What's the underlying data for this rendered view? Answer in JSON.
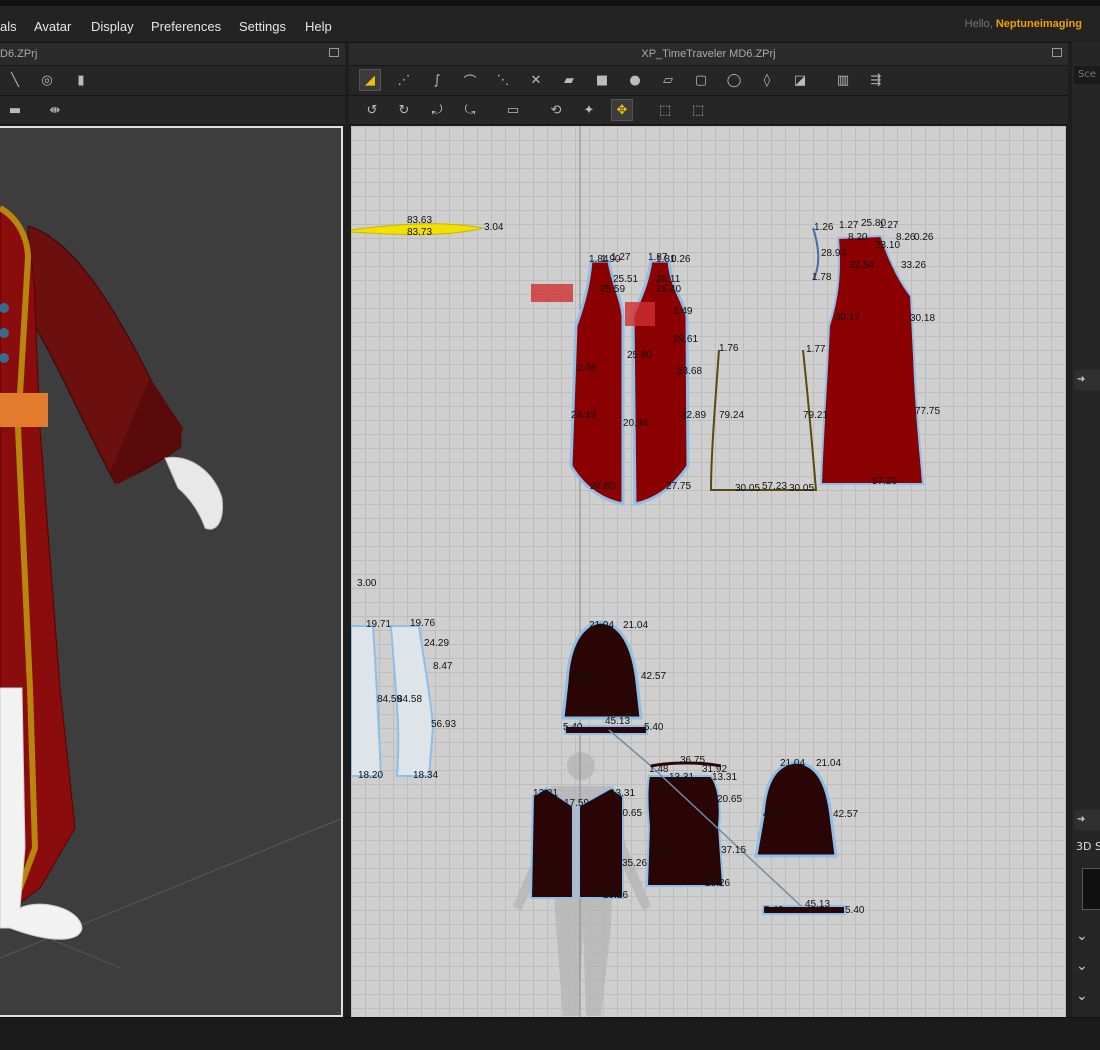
{
  "menu": {
    "items": [
      "als",
      "Avatar",
      "Display",
      "Preferences",
      "Settings",
      "Help"
    ],
    "hello_prefix": "Hello,",
    "user": "Neptuneimaging"
  },
  "panel3d": {
    "title": "D6.ZPrj"
  },
  "panel2d": {
    "title": "XP_TimeTraveler MD6.ZPrj"
  },
  "right_panel": {
    "search_label": "Sce",
    "section_label": "3D S"
  },
  "patterns": {
    "labels": [
      "83.63",
      "83.73",
      "3.04",
      "1.84",
      "1.90",
      "1.27",
      "1.87",
      "1.81",
      "0.26",
      "25.51",
      "25.59",
      "26.11",
      "26.40",
      "1.49",
      "29.61",
      "2.06",
      "24.49",
      "20.94",
      "25.80",
      "33.68",
      "32.89",
      "24.80",
      "27.75",
      "1.76",
      "1.77",
      "79.24",
      "79.21",
      "30.05",
      "57.23",
      "30.05",
      "1.26",
      "1.27",
      "25.80",
      "1.27",
      "0.26",
      "8.20",
      "8.26",
      "23.10",
      "28.94",
      "32.54",
      "33.26",
      "1.78",
      "30.17",
      "30.18",
      "77.75",
      "57.20",
      "3.00",
      "19.71",
      "19.76",
      "24.29",
      "8.47",
      "84.59",
      "84.58",
      "56.93",
      "18.20",
      "18.34",
      "21.04",
      "21.04",
      "42.57",
      "42.57",
      "5.40",
      "45.13",
      "5.40",
      "13.31",
      "17.59",
      "13.31",
      "20.65",
      "35.25",
      "35.26",
      "20.26",
      "36.75",
      "1.48",
      "13.31",
      "31.92",
      "13.31",
      "20.65",
      "37.15",
      "37.15",
      "20.26",
      "21.04",
      "21.04",
      "42.57",
      "42.57",
      "5.40",
      "45.13",
      "5.40"
    ]
  },
  "colors": {
    "accent": "#f0a000",
    "garment_red": "#8b0000",
    "garment_dark": "#2a0505",
    "select_outline": "#8fbfe6",
    "selected_yellow": "#f2e000"
  }
}
